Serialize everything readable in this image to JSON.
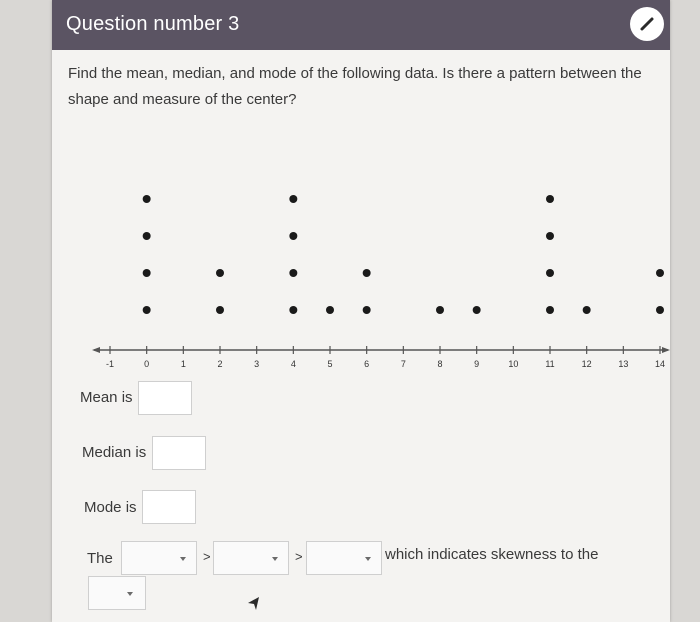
{
  "header": {
    "title": "Question number 3",
    "icon": "pencil-icon"
  },
  "question": {
    "text": "Find the mean, median, and mode of the following data. Is there a pattern between the shape and measure of the center?"
  },
  "chart_data": {
    "type": "scatter",
    "subtype": "dot-plot",
    "ticks": [
      "-1",
      "0",
      "1",
      "2",
      "3",
      "4",
      "5",
      "6",
      "7",
      "8",
      "9",
      "10",
      "11",
      "12",
      "13",
      "14"
    ],
    "xlim": [
      -1,
      14
    ],
    "points": [
      {
        "x": 0,
        "count": 4
      },
      {
        "x": 2,
        "count": 2
      },
      {
        "x": 4,
        "count": 4
      },
      {
        "x": 5,
        "count": 1
      },
      {
        "x": 6,
        "count": 2
      },
      {
        "x": 8,
        "count": 1
      },
      {
        "x": 9,
        "count": 1
      },
      {
        "x": 11,
        "count": 4
      },
      {
        "x": 12,
        "count": 1
      },
      {
        "x": 14,
        "count": 2
      }
    ]
  },
  "answers": {
    "mean_label": "Mean is",
    "median_label": "Median is",
    "mode_label": "Mode is",
    "mean_value": "",
    "median_value": "",
    "mode_value": ""
  },
  "comparison": {
    "prefix": "The",
    "separator_1": ">",
    "separator_2": ">",
    "suffix": "which indicates skewness to the",
    "select_1": "",
    "select_2": "",
    "select_3": "",
    "select_4": ""
  },
  "colors": {
    "header_bg": "#5b5463",
    "card_bg": "#f4f3f1",
    "dot": "#1a1a1a"
  }
}
